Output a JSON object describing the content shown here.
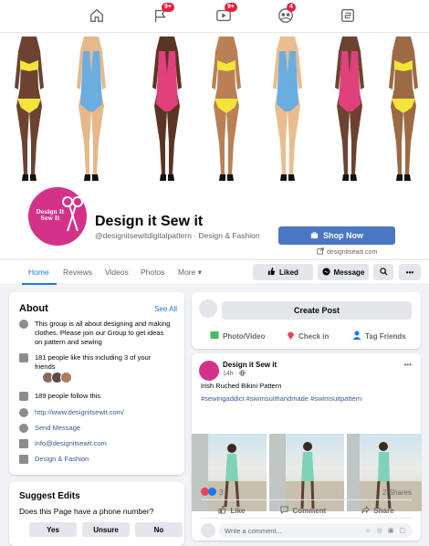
{
  "nav": {
    "badges": {
      "flag": "9+",
      "video": "9+",
      "groups": "4"
    }
  },
  "page": {
    "avatar_text": "Design It Sew It",
    "name": "Design it Sew it",
    "handle": "@designitsewitdigitalpattern · Design & Fashion",
    "shop_label": "Shop Now",
    "website": "designitsewit.com"
  },
  "tabs": {
    "items": [
      "Home",
      "Reviews",
      "Videos",
      "Photos",
      "More ▾"
    ],
    "liked": "Liked",
    "message": "Message"
  },
  "about": {
    "title": "About",
    "see_all": "See All",
    "description": "This group is all about designing and making clothes. Please join our Group to get ideas on pattern and sewing",
    "likes": "181 people like this including 3 of your friends",
    "follows": "189 people follow this",
    "website": "http://www.designitsewit.com/",
    "send_message": "Send Message",
    "email": "info@designitsewit.com",
    "category": "Design & Fashion"
  },
  "suggest": {
    "title": "Suggest Edits",
    "question": "Does this Page have a phone number?",
    "yes": "Yes",
    "unsure": "Unsure",
    "no": "No"
  },
  "create_post": {
    "button": "Create Post",
    "photo_video": "Photo/Video",
    "check_in": "Check in",
    "tag_friends": "Tag Friends"
  },
  "post": {
    "author": "Design it Sew it",
    "time": "14h · ",
    "more": "•••",
    "title": "Irish Ruched Bikini Pattern",
    "hashtags": "#sewingaddict #swimsuithandmade #swimsuitpattern",
    "reactions": "3",
    "shares": "2 Shares",
    "like": "Like",
    "comment": "Comment",
    "share": "Share",
    "comment_placeholder": "Write a comment..."
  },
  "colors": {
    "accent": "#1877f2",
    "shop_button": "#4a76c4",
    "brand_pink": "#d4328a"
  }
}
